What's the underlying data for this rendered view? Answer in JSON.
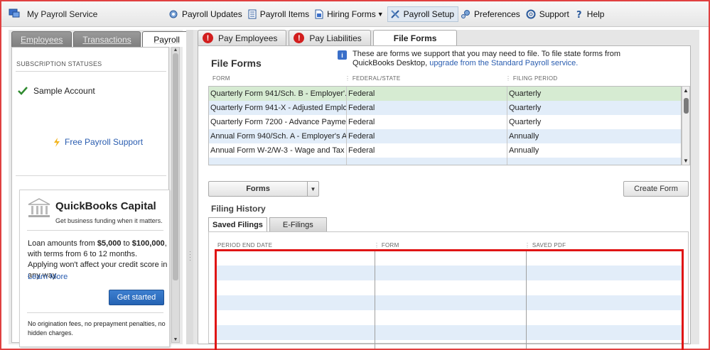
{
  "toolbar": {
    "app_title": "My Payroll Service",
    "menu": [
      {
        "label": "Payroll Updates",
        "icon": "gear-refresh-icon"
      },
      {
        "label": "Payroll Items",
        "icon": "list-icon"
      },
      {
        "label": "Hiring Forms",
        "icon": "document-icon",
        "dropdown": true
      },
      {
        "label": "Payroll Setup",
        "icon": "tools-icon",
        "active": true
      },
      {
        "label": "Preferences",
        "icon": "preferences-icon"
      },
      {
        "label": "Support",
        "icon": "lifebuoy-icon"
      },
      {
        "label": "Help",
        "icon": "question-icon"
      }
    ]
  },
  "left": {
    "tabs": [
      "Employees",
      "Transactions",
      "Payroll"
    ],
    "selected_tab": "Payroll",
    "subscription_header": "SUBSCRIPTION STATUSES",
    "account_name": "Sample Account",
    "support_link": "Free Payroll Support",
    "capital": {
      "title": "QuickBooks Capital",
      "subtitle": "Get business funding when it matters.",
      "text_1": "Loan amounts from ",
      "amount_low": "$5,000",
      "text_2": " to ",
      "amount_high": "$100,000",
      "text_3": ", with terms from 6 to 12 months. Applying won't affect your credit score in any way.",
      "learn_more": "Learn More",
      "button": "Get started",
      "footer": "No origination fees, no prepayment penalties, no hidden charges."
    }
  },
  "right": {
    "tabs": [
      {
        "label": "Pay Employees",
        "alert": true
      },
      {
        "label": "Pay Liabilities",
        "alert": true
      },
      {
        "label": "File Forms",
        "alert": false
      }
    ],
    "selected_tab": "File Forms",
    "section_title": "File Forms",
    "info_text": "These are forms we support that you may need to file. To file state forms from QuickBooks Desktop, ",
    "info_link": "upgrade from the Standard Payroll service.",
    "forms_grid": {
      "columns": [
        "FORM",
        "FEDERAL/STATE",
        "FILING PERIOD"
      ],
      "rows": [
        [
          "Quarterly Form 941/Sch. B - Employer'...",
          "Federal",
          "Quarterly"
        ],
        [
          "Quarterly Form 941-X - Adjusted Emplo...",
          "Federal",
          "Quarterly"
        ],
        [
          "Quarterly Form 7200 - Advance Payme...",
          "Federal",
          "Quarterly"
        ],
        [
          "Annual Form 940/Sch. A - Employer's A...",
          "Federal",
          "Annually"
        ],
        [
          "Annual Form W-2/W-3 - Wage and Tax ...",
          "Federal",
          "Annually"
        ]
      ]
    },
    "forms_button": "Forms",
    "create_form_button": "Create Form",
    "history_title": "Filing History",
    "history_tabs": [
      "Saved Filings",
      "E-Filings"
    ],
    "history_grid": {
      "columns": [
        "PERIOD END DATE",
        "FORM",
        "SAVED PDF"
      ]
    }
  }
}
